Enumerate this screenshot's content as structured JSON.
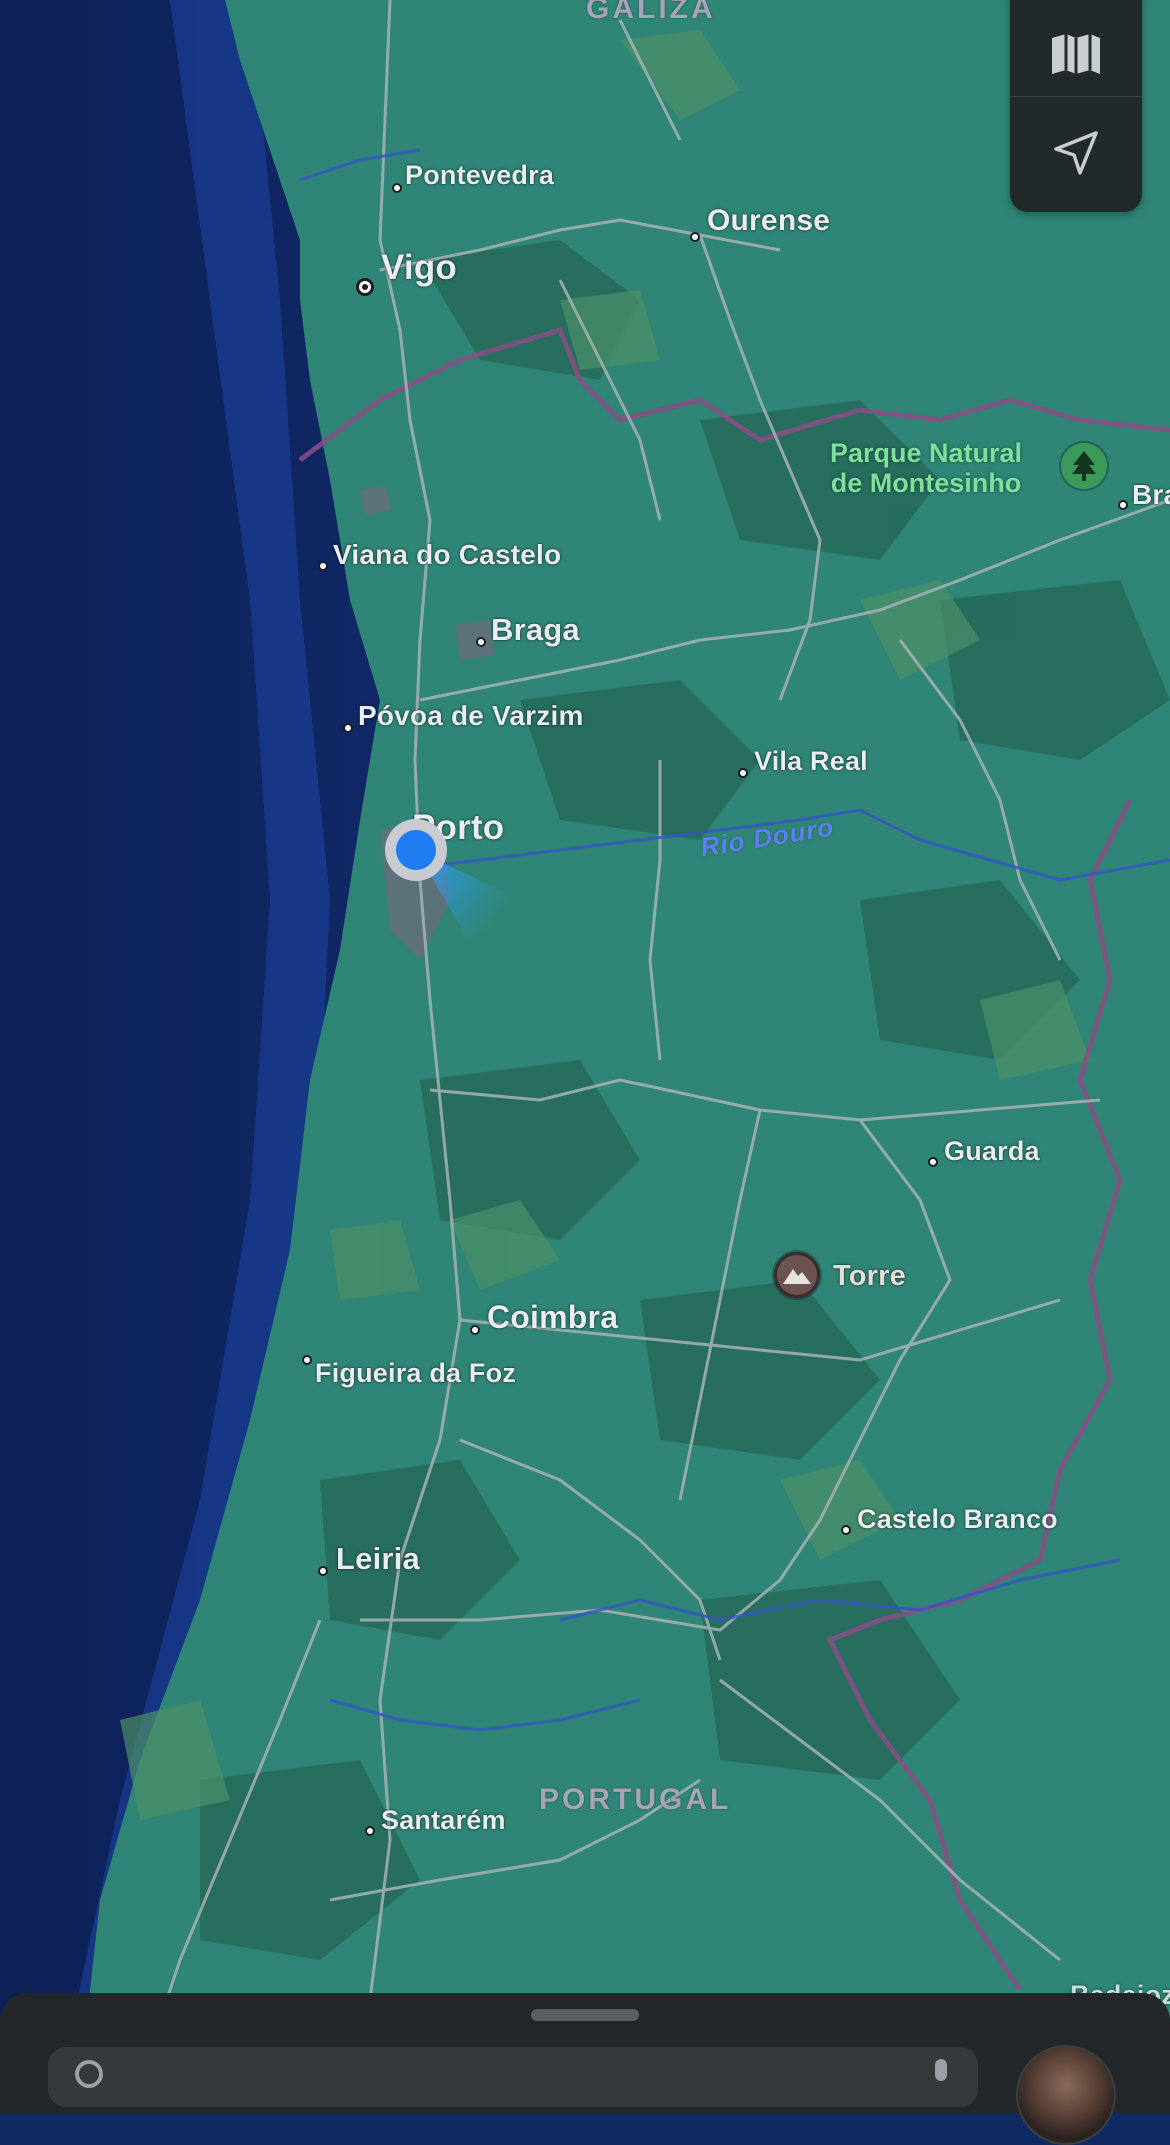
{
  "map": {
    "regions": {
      "galiza": "GALIZA",
      "portugal": "PORTUGAL"
    },
    "cities": {
      "pontevedra": "Pontevedra",
      "vigo": "Vigo",
      "ourense": "Ourense",
      "viana": "Viana do Castelo",
      "braga": "Braga",
      "povoa": "Póvoa de Varzim",
      "vila_real": "Vila Real",
      "porto": "Porto",
      "guarda": "Guarda",
      "coimbra": "Coimbra",
      "figueira": "Figueira da Foz",
      "castelo_branco": "Castelo Branco",
      "leiria": "Leiria",
      "santarem": "Santarém",
      "bra_cut": "Bra",
      "badajoz_cut": "Badajoz"
    },
    "river": "Rio Douro",
    "park": {
      "line1": "Parque Natural",
      "line2": "de Montesinho",
      "icon": "tree-icon"
    },
    "peak": {
      "label": "Torre",
      "icon": "mountain-icon"
    },
    "colors": {
      "ocean": "#13307a",
      "land": "#2f8676",
      "forest": "#2a6f5f",
      "road": "#a7b3b6",
      "border": "#8a4f86",
      "user_location": "#1f7cf2"
    }
  },
  "controls": {
    "map_mode_icon": "map-icon",
    "locate_icon": "location-arrow-icon"
  },
  "bottom_sheet": {
    "search_icon": "search-icon",
    "mic_icon": "microphone-icon",
    "avatar": "profile-avatar"
  }
}
